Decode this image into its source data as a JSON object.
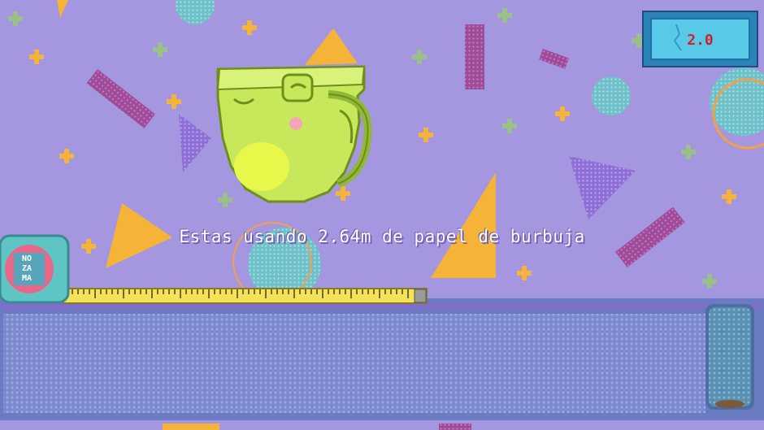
{
  "message": "Estas usando 2.64m de papel de burbuja",
  "score": {
    "value": "2.0",
    "icon": "crack-icon"
  },
  "badge": {
    "line1": "NO",
    "line2": "ZA",
    "line3": "MA"
  },
  "tape_measure": {
    "extended_fraction": 0.47
  },
  "colors": {
    "background": "#a597df",
    "bubble_wrap": "#7b8fd0",
    "frog_cup": "#c6e85a",
    "tape": "#f3e25a",
    "score_panel": "#58c9e6",
    "score_text": "#d0222e"
  }
}
